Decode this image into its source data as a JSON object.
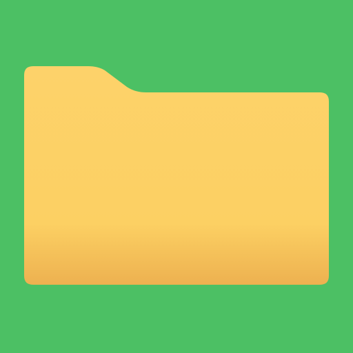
{
  "icon": {
    "name": "folder-icon",
    "background_color": "#4CC064",
    "folder_color_top": "#FDD26A",
    "folder_color_mid": "#FCD063",
    "folder_color_bottom": "#EDB150"
  }
}
